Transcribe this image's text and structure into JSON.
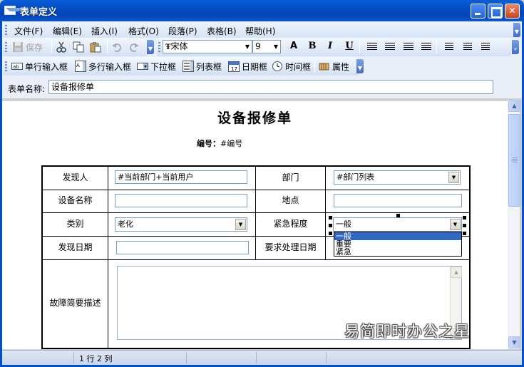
{
  "window": {
    "title": "表单定义"
  },
  "menu": [
    "文件(F)",
    "编辑(E)",
    "插入(I)",
    "格式(O)",
    "段落(P)",
    "表格(B)",
    "帮助(H)"
  ],
  "toolbar1": {
    "save_label": "保存",
    "font_name": "宋体",
    "font_size": "9",
    "bold": "B",
    "italic": "I",
    "underline": "U",
    "font_glyph": "A"
  },
  "toolbar2": {
    "single_input": "单行输入框",
    "multi_input": "多行输入框",
    "dropdown": "下拉框",
    "listbox": "列表框",
    "date_box": "日期框",
    "time_box": "时间框",
    "properties": "属性"
  },
  "form_name": {
    "label": "表单名称:",
    "value": "设备报修单"
  },
  "document": {
    "title": "设备报修单",
    "number_label": "编号：",
    "number_value": "#编号",
    "rows": [
      {
        "label1": "发现人",
        "value1": "#当前部门+当前用户",
        "label2": "部门",
        "value2": "#部门列表"
      },
      {
        "label1": "设备名称",
        "value1": "",
        "label2": "地点",
        "value2": ""
      },
      {
        "label1": "类别",
        "value1": "老化",
        "label2": "紧急程度",
        "value2": "一般"
      },
      {
        "label1": "发现日期",
        "value1": "",
        "label2": "要求处理日期",
        "value2": ""
      },
      {
        "label1": "故障简要描述",
        "value1": ""
      }
    ],
    "urgency_options": [
      "一般",
      "重要",
      "紧急"
    ]
  },
  "status": {
    "position": "1 行  2 列"
  },
  "watermark": "易简即时办公之星"
}
